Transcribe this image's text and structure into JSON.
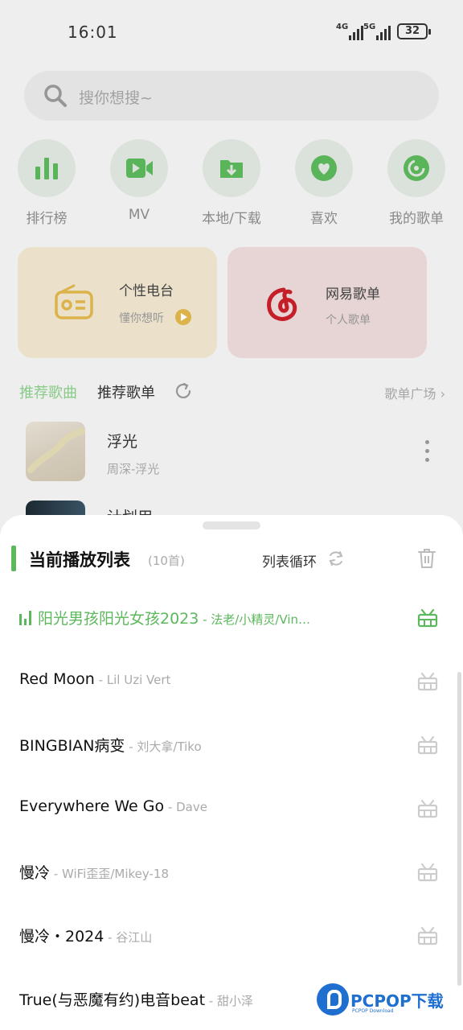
{
  "status": {
    "time": "16:01",
    "net1": "4G",
    "net2": "5G",
    "battery": "32"
  },
  "search": {
    "placeholder": "搜你想搜~"
  },
  "quick_nav": [
    {
      "label": "排行榜",
      "icon": "bar-chart-icon"
    },
    {
      "label": "MV",
      "icon": "video-camera-icon"
    },
    {
      "label": "本地/下载",
      "icon": "download-folder-icon"
    },
    {
      "label": "喜欢",
      "icon": "heart-icon"
    },
    {
      "label": "我的歌单",
      "icon": "disc-icon"
    }
  ],
  "cards": {
    "radio": {
      "title": "个性电台",
      "subtitle": "懂你想听"
    },
    "netease": {
      "title": "网易歌单",
      "subtitle": "个人歌单"
    }
  },
  "recommend": {
    "tab_songs": "推荐歌曲",
    "tab_playlists": "推荐歌单",
    "more": "歌单广场 ›",
    "songs": [
      {
        "title": "浮光",
        "subtitle": "周深-浮光"
      },
      {
        "title": "计划用",
        "subtitle": ""
      }
    ]
  },
  "playlist": {
    "title": "当前播放列表",
    "count": "(10首)",
    "mode": "列表循环",
    "tracks": [
      {
        "name": "阳光男孩阳光女孩2023",
        "artist": " - 法老/小精灵/Vin…",
        "playing": true
      },
      {
        "name": "Red Moon",
        "artist": " - Lil Uzi Vert",
        "playing": false
      },
      {
        "name": "BINGBIAN病变",
        "artist": " - 刘大拿/Tiko",
        "playing": false
      },
      {
        "name": "Everywhere We Go",
        "artist": " - Dave",
        "playing": false
      },
      {
        "name": "慢冷",
        "artist": " - WiFi歪歪/Mikey-18",
        "playing": false
      },
      {
        "name": "慢冷・2024",
        "artist": " - 谷江山",
        "playing": false
      },
      {
        "name": "True(与恶魔有约)电音beat",
        "artist": " - 甜小泽",
        "playing": false
      }
    ]
  },
  "watermark": {
    "brand": "PCPOP下载",
    "small": "PCPOP Download"
  },
  "colors": {
    "accent": "#5cb85c",
    "radio_card": "#f0e6cf",
    "netease_card": "#ecd9d9",
    "netease_red": "#c8202a",
    "radio_yellow": "#e0b74c"
  }
}
